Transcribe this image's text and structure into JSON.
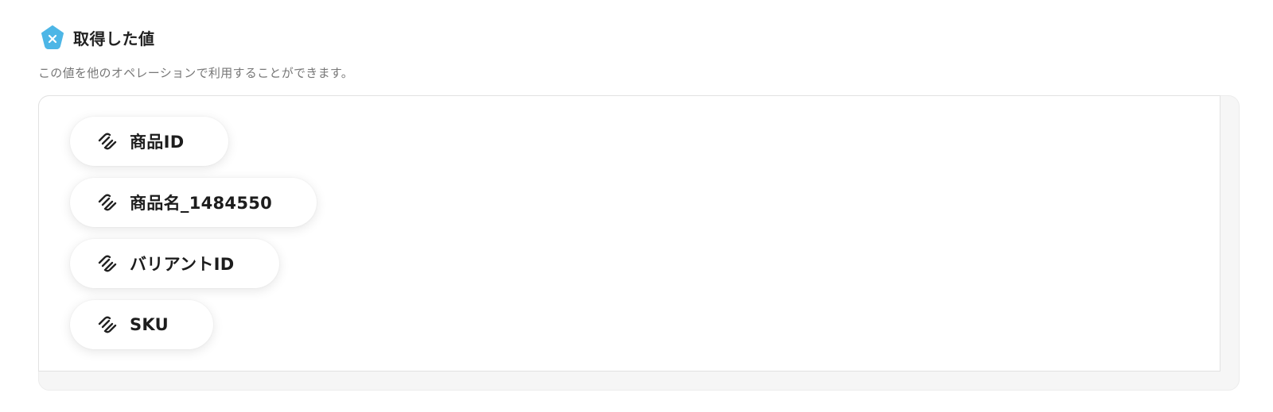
{
  "header": {
    "title": "取得した値",
    "icon": "yoom-app-icon",
    "icon_color": "#4db6e6"
  },
  "description": "この値を他のオペレーションで利用することができます。",
  "values": [
    {
      "label": "商品ID",
      "icon": "squarespace-icon"
    },
    {
      "label": "商品名_1484550",
      "icon": "squarespace-icon"
    },
    {
      "label": "バリアントID",
      "icon": "squarespace-icon"
    },
    {
      "label": "SKU",
      "icon": "squarespace-icon"
    }
  ]
}
